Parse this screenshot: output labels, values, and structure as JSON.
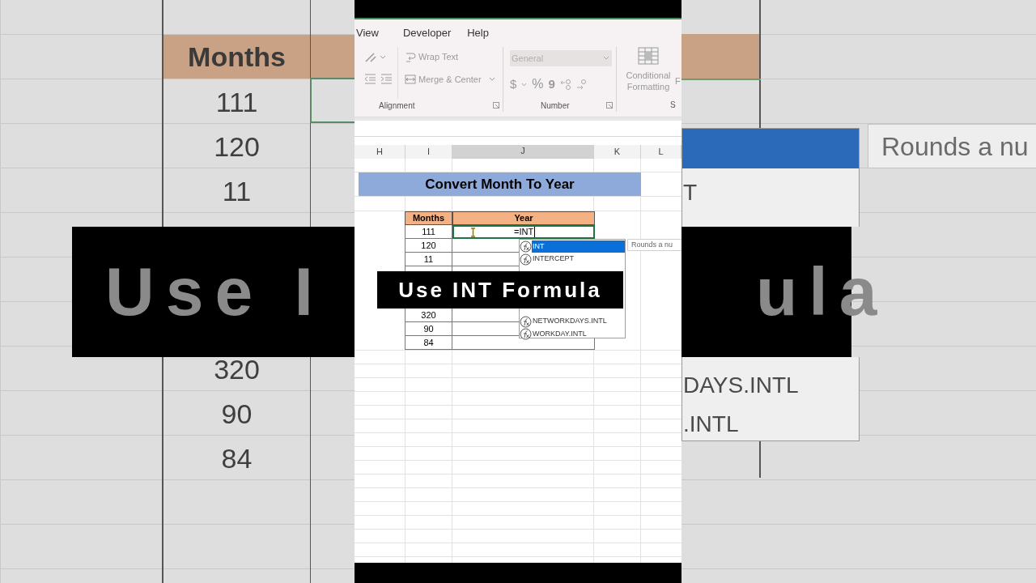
{
  "backdrop_left": {
    "header": "Months",
    "values": [
      "111",
      "120",
      "11",
      "320",
      "90",
      "84"
    ],
    "caption": "Use I"
  },
  "backdrop_right": {
    "list": [
      "T",
      "DAYS.INTL",
      ".INTL"
    ],
    "caption": "ula",
    "tooltip": "Rounds a nu"
  },
  "ribbon": {
    "tabs": [
      {
        "label": "View"
      },
      {
        "label": "Developer"
      },
      {
        "label": "Help"
      }
    ],
    "alignment": {
      "label": "Alignment",
      "wrap": "Wrap Text",
      "merge": "Merge & Center"
    },
    "number": {
      "label": "Number",
      "format": "General",
      "symbols": [
        "$",
        "%",
        "9"
      ]
    },
    "styles": {
      "label": "S",
      "buttons": [
        "Conditional Formatting",
        "F"
      ]
    }
  },
  "columns": [
    {
      "label": "H",
      "selected": false
    },
    {
      "label": "I",
      "selected": false
    },
    {
      "label": "J",
      "selected": true
    },
    {
      "label": "K",
      "selected": false
    },
    {
      "label": "L",
      "selected": false
    }
  ],
  "title": "Convert Month To Year",
  "table": {
    "columns": [
      "Months",
      "Year"
    ],
    "rows_top": [
      {
        "months": "111",
        "year": "=INT",
        "selected": true
      },
      {
        "months": "120",
        "selected": false
      },
      {
        "months": "11",
        "selected": false
      }
    ],
    "rows_bottom": [
      {
        "months": "320",
        "selected": false
      },
      {
        "months": "90",
        "selected": false
      },
      {
        "months": "84",
        "selected": false
      }
    ]
  },
  "autocomplete": {
    "top": [
      {
        "label": "INT",
        "selected": true
      },
      {
        "label": "INTERCEPT",
        "selected": false
      }
    ],
    "bottom": [
      {
        "label": "NETWORKDAYS.INTL",
        "selected": false
      },
      {
        "label": "WORKDAY.INTL",
        "selected": false
      }
    ],
    "tooltip": "Rounds a nu"
  },
  "caption": "Use INT Formula"
}
